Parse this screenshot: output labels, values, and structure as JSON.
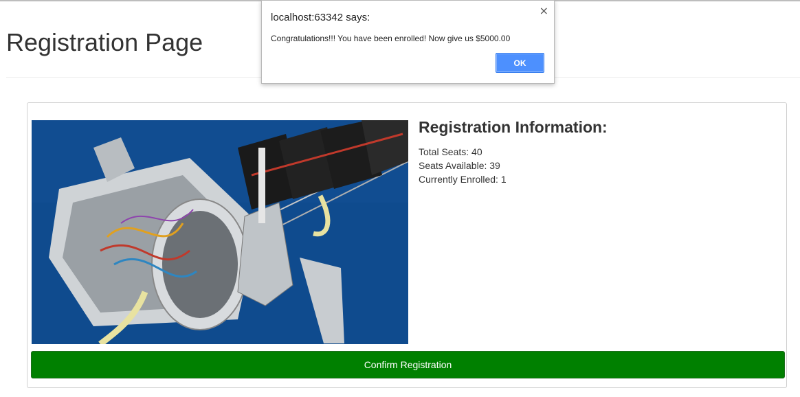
{
  "page": {
    "title": "Registration Page"
  },
  "registration": {
    "heading": "Registration Information:",
    "stats": [
      {
        "label": "Total Seats:",
        "value": "40"
      },
      {
        "label": "Seats Available:",
        "value": "39"
      },
      {
        "label": "Currently Enrolled:",
        "value": "1"
      }
    ],
    "confirm_label": "Confirm Registration",
    "photo_icon": "robot-photo"
  },
  "alert": {
    "title": "localhost:63342 says:",
    "message": "Congratulations!!! You have been enrolled! Now give us $5000.00",
    "ok_label": "OK",
    "close_glyph": "×"
  },
  "colors": {
    "confirm_bg": "#008000",
    "ok_bg": "#4d90fe",
    "photo_bg": "#0f4b8e"
  }
}
